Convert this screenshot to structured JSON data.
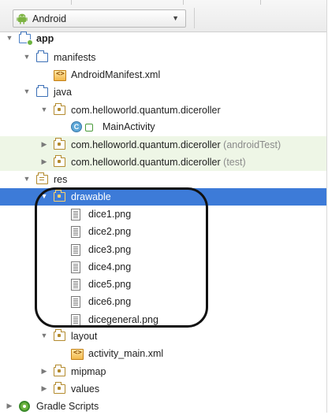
{
  "header": {
    "view_label": "Android",
    "icon": "android-robot-icon",
    "dropdown_icon": "chevron-down-icon"
  },
  "tree": [
    {
      "id": "app",
      "label": "app",
      "bold": true,
      "icon": "app-module-folder-icon",
      "expanded": true
    },
    {
      "id": "manifests",
      "label": "manifests",
      "icon": "folder-icon",
      "expanded": true
    },
    {
      "id": "androidmanifest",
      "label": "AndroidManifest.xml",
      "icon": "xml-file-icon"
    },
    {
      "id": "java",
      "label": "java",
      "icon": "folder-icon",
      "expanded": true
    },
    {
      "id": "pkg-main",
      "label": "com.helloworld.quantum.diceroller",
      "suffix": "",
      "icon": "package-icon",
      "expanded": true
    },
    {
      "id": "mainactivity",
      "label": "MainActivity",
      "icon": "class-icon"
    },
    {
      "id": "pkg-androidtest",
      "label": "com.helloworld.quantum.diceroller",
      "suffix": "(androidTest)",
      "icon": "package-icon",
      "expanded": false
    },
    {
      "id": "pkg-test",
      "label": "com.helloworld.quantum.diceroller",
      "suffix": "(test)",
      "icon": "package-icon",
      "expanded": false
    },
    {
      "id": "res",
      "label": "res",
      "icon": "resource-folder-icon",
      "expanded": true
    },
    {
      "id": "drawable",
      "label": "drawable",
      "icon": "package-icon",
      "expanded": true,
      "selected": true
    },
    {
      "id": "dice1",
      "label": "dice1.png",
      "icon": "image-file-icon"
    },
    {
      "id": "dice2",
      "label": "dice2.png",
      "icon": "image-file-icon"
    },
    {
      "id": "dice3",
      "label": "dice3.png",
      "icon": "image-file-icon"
    },
    {
      "id": "dice4",
      "label": "dice4.png",
      "icon": "image-file-icon"
    },
    {
      "id": "dice5",
      "label": "dice5.png",
      "icon": "image-file-icon"
    },
    {
      "id": "dice6",
      "label": "dice6.png",
      "icon": "image-file-icon"
    },
    {
      "id": "dicegeneral",
      "label": "dicegeneral.png",
      "icon": "image-file-icon"
    },
    {
      "id": "layout",
      "label": "layout",
      "icon": "package-icon",
      "expanded": true
    },
    {
      "id": "activity_main",
      "label": "activity_main.xml",
      "icon": "xml-file-icon"
    },
    {
      "id": "mipmap",
      "label": "mipmap",
      "icon": "package-icon",
      "expanded": false
    },
    {
      "id": "values",
      "label": "values",
      "icon": "package-icon",
      "expanded": false
    },
    {
      "id": "gradle",
      "label": "Gradle Scripts",
      "icon": "gradle-icon",
      "expanded": false
    }
  ],
  "colors": {
    "selection": "#3d7bd8",
    "test_row_tint": "#eef6e6",
    "folder_blue": "#3b6fb6",
    "package_gold": "#b38a2d"
  }
}
